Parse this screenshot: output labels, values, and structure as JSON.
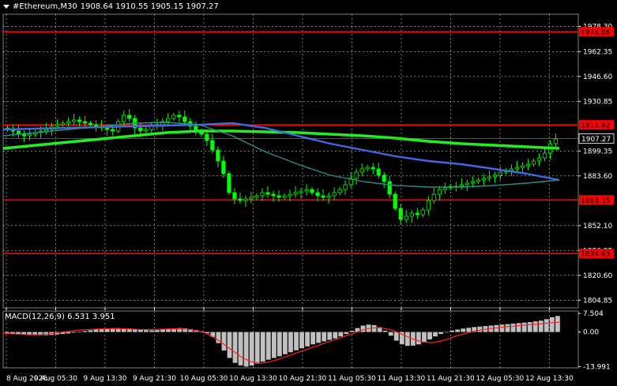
{
  "header": {
    "symbol": "#Ethereum,M30",
    "ohlc": "1908.64 1910.55 1905.15 1907.27",
    "menu_icon": "triangle-down-icon"
  },
  "indicator": {
    "label": "MACD(12,26,9) 6.531 3.951"
  },
  "colors": {
    "background": "#000000",
    "grid": "#c8c8c8",
    "candles": "#00ff00",
    "ma_slow": "#22ee22",
    "ma_mid": "#4169e1",
    "ma_fast": "#2e8b8b",
    "level_line": "#ff0000",
    "macd_hist": "#c0c0c0",
    "macd_signal": "#ff2020"
  },
  "chart_data": [
    {
      "type": "candlestick",
      "symbol": "#Ethereum",
      "timeframe": "M30",
      "ylim": [
        1800,
        1986
      ],
      "y_ticks": [
        "1978.30",
        "1962.35",
        "1946.60",
        "1930.85",
        "1899.35",
        "1883.60",
        "1852.10",
        "1836.35",
        "1820.60",
        "1804.85"
      ],
      "x_ticks": [
        "8 Aug 2026",
        "9 Aug 05:30",
        "9 Aug 13:30",
        "9 Aug 21:30",
        "10 Aug 05:30",
        "10 Aug 13:30",
        "10 Aug 21:30",
        "11 Aug 05:30",
        "11 Aug 13:30",
        "11 Aug 21:30",
        "12 Aug 05:30",
        "12 Aug 13:30"
      ],
      "current_price": "1907.27",
      "levels": [
        {
          "value": 1974.86,
          "label": "1974.86",
          "color": "#ff0000"
        },
        {
          "value": 1915.92,
          "label": "1915.92",
          "color": "#ff0000"
        },
        {
          "value": 1868.35,
          "label": "1868.35",
          "color": "#ff0000"
        },
        {
          "value": 1834.43,
          "label": "1834.43",
          "color": "#ff0000"
        }
      ],
      "price_path": [
        1913,
        1912,
        1910,
        1909,
        1910,
        1911,
        1912,
        1913,
        1915,
        1916,
        1917,
        1918,
        1919,
        1918,
        1917,
        1916,
        1915,
        1914,
        1913,
        1912,
        1918,
        1922,
        1920,
        1914,
        1912,
        1913,
        1915,
        1916,
        1918,
        1920,
        1922,
        1921,
        1918,
        1915,
        1912,
        1910,
        1906,
        1900,
        1893,
        1885,
        1873,
        1869,
        1868,
        1869,
        1870,
        1871,
        1873,
        1872,
        1871,
        1870,
        1871,
        1872,
        1873,
        1874,
        1875,
        1873,
        1871,
        1870,
        1871,
        1873,
        1875,
        1878,
        1882,
        1886,
        1888,
        1889,
        1888,
        1884,
        1880,
        1872,
        1863,
        1856,
        1858,
        1860,
        1859,
        1862,
        1868,
        1872,
        1875,
        1876,
        1877,
        1877,
        1878,
        1879,
        1880,
        1881,
        1882,
        1883,
        1884,
        1886,
        1887,
        1888,
        1889,
        1890,
        1891,
        1893,
        1895,
        1898,
        1904,
        1907
      ],
      "moving_averages": [
        {
          "color": "#22ee22",
          "values": [
            1901,
            1903,
            1905,
            1907,
            1909,
            1911,
            1912,
            1912,
            1911.5,
            1911,
            1910,
            1909,
            1907.5,
            1905.5,
            1904,
            1903,
            1902,
            1901
          ]
        },
        {
          "color": "#4169e1",
          "values": [
            1913,
            1913.5,
            1914,
            1914.5,
            1915,
            1915.5,
            1916,
            1917,
            1914,
            1909,
            1904,
            1900,
            1896,
            1893,
            1891,
            1888,
            1885,
            1881
          ]
        },
        {
          "color": "#2e8b8b",
          "values": [
            1909,
            1911,
            1913,
            1915,
            1917,
            1917.5,
            1916,
            1909,
            1899,
            1891,
            1884,
            1880,
            1877.5,
            1876.5,
            1876.5,
            1877.5,
            1879,
            1881
          ]
        }
      ]
    },
    {
      "type": "bar",
      "name": "MACD(12,26,9)",
      "main_value": 6.531,
      "signal_value": 3.951,
      "ylim": [
        -14.5,
        8.5
      ],
      "y_ticks": [
        "7.504",
        "0.00",
        "-13.991"
      ],
      "histogram": [
        -0.5,
        -0.6,
        -0.8,
        -1.0,
        -1.1,
        -1.2,
        -1.3,
        -1.3,
        -1.2,
        -1.0,
        -0.8,
        -0.6,
        -0.3,
        0.0,
        0.4,
        0.7,
        1.0,
        1.3,
        1.4,
        1.5,
        1.6,
        1.5,
        1.4,
        1.2,
        1.0,
        0.8,
        0.7,
        0.8,
        1.0,
        1.3,
        1.5,
        1.6,
        1.5,
        1.2,
        0.8,
        0.3,
        -0.5,
        -2.0,
        -4.5,
        -7.5,
        -10.5,
        -12.5,
        -13.5,
        -14.0,
        -13.6,
        -12.8,
        -12.0,
        -11.2,
        -10.5,
        -9.8,
        -9.0,
        -8.2,
        -7.4,
        -6.6,
        -5.8,
        -5.0,
        -4.4,
        -3.8,
        -3.2,
        -2.6,
        -1.8,
        -0.8,
        0.5,
        1.6,
        2.6,
        3.0,
        2.8,
        2.0,
        0.5,
        -1.5,
        -3.5,
        -5.0,
        -5.6,
        -5.5,
        -5.0,
        -4.0,
        -3.0,
        -1.8,
        -0.8,
        0.0,
        0.6,
        1.0,
        1.4,
        1.7,
        2.0,
        2.2,
        2.4,
        2.6,
        2.8,
        3.0,
        3.2,
        3.4,
        3.6,
        3.8,
        4.0,
        4.3,
        4.6,
        5.2,
        6.0,
        6.5
      ],
      "signal": [
        -0.5,
        -0.7,
        -0.9,
        -1.1,
        -1.1,
        -0.9,
        -0.5,
        0.0,
        0.4,
        0.8,
        1.0,
        1.2,
        1.3,
        1.4,
        1.3,
        1.2,
        1.0,
        1.0,
        1.1,
        1.2,
        1.3,
        1.2,
        0.9,
        0.3,
        -1.0,
        -3.0,
        -5.5,
        -8.0,
        -10.5,
        -12.0,
        -12.6,
        -12.2,
        -11.2,
        -10.0,
        -8.8,
        -7.6,
        -6.4,
        -5.2,
        -4.0,
        -2.8,
        -1.6,
        -0.4,
        0.8,
        1.6,
        1.8,
        1.2,
        0.0,
        -1.5,
        -3.0,
        -4.0,
        -4.3,
        -3.8,
        -2.8,
        -1.6,
        -0.6,
        0.3,
        0.9,
        1.4,
        1.8,
        2.2,
        2.5,
        2.8,
        3.1,
        3.4,
        3.7,
        3.95
      ]
    }
  ]
}
